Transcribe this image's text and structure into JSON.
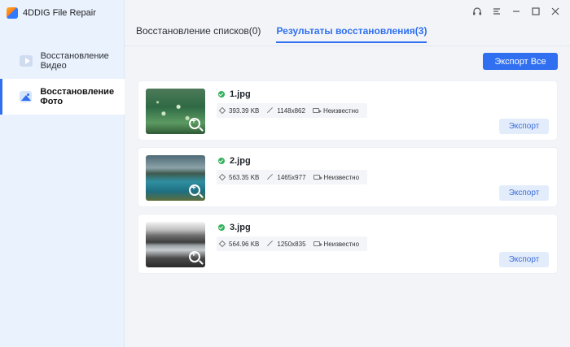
{
  "app": {
    "title": "4DDIG File Repair"
  },
  "sidebar": {
    "items": [
      {
        "label": "Восстановление Видео",
        "icon": "video-icon",
        "active": false
      },
      {
        "label": "Восстановление Фото",
        "icon": "photo-icon",
        "active": true
      }
    ]
  },
  "window_controls": [
    "headset-icon",
    "menu-icon",
    "minimize-icon",
    "maximize-icon",
    "close-icon"
  ],
  "tabs": [
    {
      "label": "Восстановление списков(0)",
      "active": false
    },
    {
      "label": "Результаты восстановления(3)",
      "active": true
    }
  ],
  "toolbar": {
    "export_all_label": "Экспорт Все"
  },
  "files": [
    {
      "name": "1.jpg",
      "size": "393.39 KB",
      "resolution": "1148x862",
      "duration": "Неизвестно",
      "export_label": "Экспорт",
      "status": "success"
    },
    {
      "name": "2.jpg",
      "size": "563.35 KB",
      "resolution": "1465x977",
      "duration": "Неизвестно",
      "export_label": "Экспорт",
      "status": "success"
    },
    {
      "name": "3.jpg",
      "size": "564.96 KB",
      "resolution": "1250x835",
      "duration": "Неизвестно",
      "export_label": "Экспорт",
      "status": "success"
    }
  ],
  "colors": {
    "accent": "#2f6ff0",
    "success": "#31b25a",
    "sidebar_bg": "#eaf2fd"
  }
}
